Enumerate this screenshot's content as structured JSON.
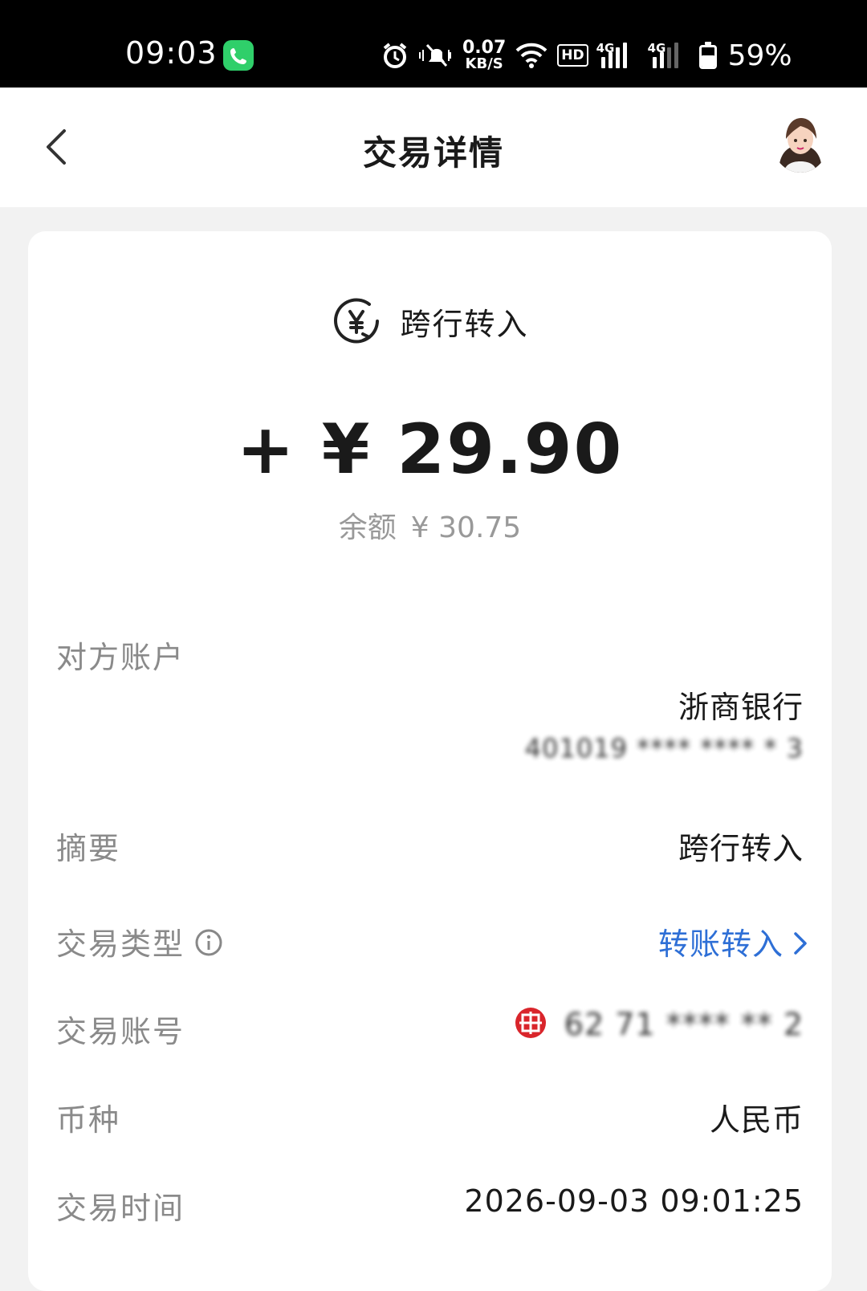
{
  "status_bar": {
    "time": "09:03",
    "speed_value": "0.07",
    "speed_unit": "KB/S",
    "hd_label": "HD",
    "net1_label": "4G",
    "net2_label": "4G",
    "battery_level": 0.59,
    "battery_percent": "59%"
  },
  "header": {
    "title": "交易详情"
  },
  "transaction": {
    "type_label": "跨行转入",
    "amount": "+ ¥ 29.90",
    "balance_label": "余额",
    "balance_value": "¥ 30.75"
  },
  "details": {
    "counterparty_label": "对方账户",
    "counterparty_bank": "浙商银行",
    "counterparty_account": "401019 **** **** * 3",
    "summary_label": "摘要",
    "summary_value": "跨行转入",
    "tx_type_label": "交易类型",
    "tx_type_value": "转账转入",
    "tx_account_label": "交易账号",
    "tx_account_value": "62  71 **** ** 2",
    "currency_label": "币种",
    "currency_value": "人民币",
    "time_label": "交易时间",
    "time_value": "2026-09-03 09:01:25"
  },
  "colors": {
    "accent_blue": "#2e6fd6",
    "bank_red": "#d9252b",
    "call_green": "#2fcf6a"
  }
}
